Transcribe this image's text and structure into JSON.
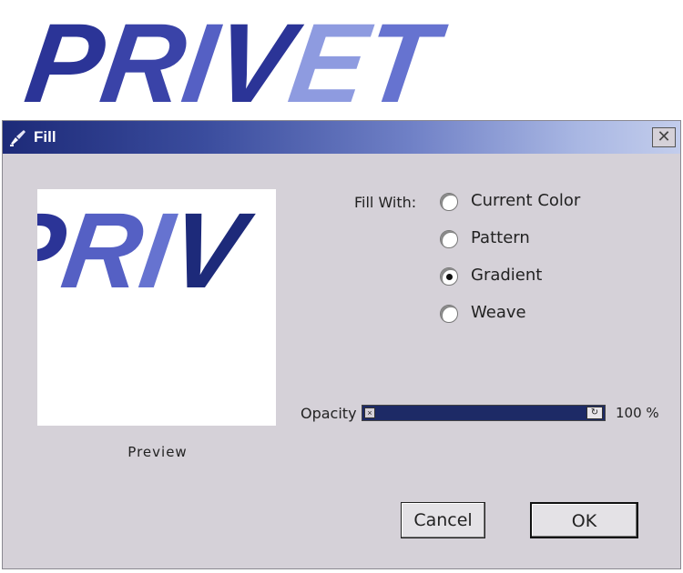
{
  "banner": {
    "logo_text": "PRIVET"
  },
  "dialog": {
    "title": "Fill",
    "close_glyph": "✕",
    "preview_label": "Preview",
    "preview_text": "PRIV",
    "fill_with_label": "Fill With:",
    "options": [
      {
        "label": "Current Color",
        "selected": false
      },
      {
        "label": "Pattern",
        "selected": false
      },
      {
        "label": "Gradient",
        "selected": true
      },
      {
        "label": "Weave",
        "selected": false
      }
    ],
    "opacity_label": "Opacity",
    "opacity_value": "100 %",
    "opacity_fraction": 1.0,
    "buttons": {
      "cancel": "Cancel",
      "ok": "OK"
    }
  },
  "colors": {
    "logo_dark": "#2b3497",
    "logo_mid": "#5560c4",
    "logo_light": "#8e9be0",
    "titlebar_start": "#1d2a78",
    "titlebar_end": "#c3cdec",
    "dialog_bg": "#d5d1d8",
    "slider_fill": "#1d2a66"
  },
  "icons": {
    "title_icon": "brush-icon",
    "close_icon": "close-icon"
  }
}
